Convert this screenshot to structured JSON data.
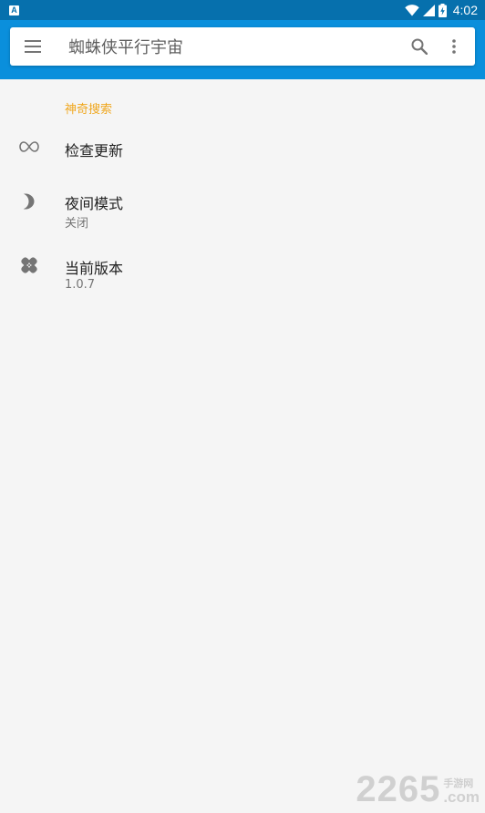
{
  "status_bar": {
    "time": "4:02",
    "notification_letter": "A",
    "icons": [
      "wifi-icon",
      "signal-icon",
      "battery-charging-icon"
    ]
  },
  "app_bar": {
    "title": "蜘蛛侠平行宇宙",
    "menu_icon": "hamburger-menu-icon",
    "search_icon": "search-icon",
    "overflow_icon": "more-vert-icon",
    "color": "#0a8fdc",
    "status_color": "#0670ad"
  },
  "settings": {
    "section_header": "神奇搜索",
    "header_color": "#f0a820",
    "items": [
      {
        "icon": "infinity-icon",
        "title": "检查更新",
        "subtitle": ""
      },
      {
        "icon": "moon-icon",
        "title": "夜间模式",
        "subtitle": "关闭"
      },
      {
        "icon": "bandage-icon",
        "title": "当前版本",
        "subtitle": "1.0.7"
      }
    ]
  },
  "watermark": {
    "number": "2265",
    "cn": "手游网",
    "domain": ".com"
  }
}
